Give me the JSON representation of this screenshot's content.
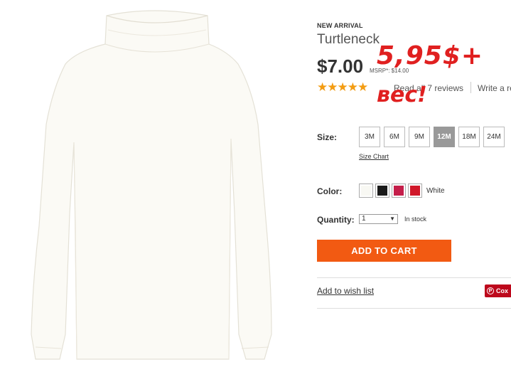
{
  "product": {
    "badge": "NEW ARRIVAL",
    "title": "Turtleneck",
    "price": "$7.00",
    "msrp": "MSRP*: $14.00",
    "rating_stars": "★★★★★",
    "rating_value": 5,
    "reviews_link": "Read all 7 reviews",
    "write_review": "Write a re"
  },
  "annotation": {
    "price_note": "5,95$+",
    "weight_note": "вес!",
    "color": "#e02020"
  },
  "size": {
    "label": "Size:",
    "options": [
      "3M",
      "6M",
      "9M",
      "12M",
      "18M",
      "24M"
    ],
    "selected": "12M",
    "chart_link": "Size Chart"
  },
  "color": {
    "label": "Color:",
    "swatches": [
      {
        "name": "white",
        "hex": "#f8f8f3"
      },
      {
        "name": "black",
        "hex": "#1a1a1a"
      },
      {
        "name": "raspberry",
        "hex": "#c41e4a"
      },
      {
        "name": "red",
        "hex": "#d0182a"
      }
    ],
    "selected_name": "White"
  },
  "quantity": {
    "label": "Quantity:",
    "value": "1",
    "stock_status": "In stock"
  },
  "actions": {
    "add_to_cart": "ADD TO CART",
    "wishlist": "Add to wish list",
    "pin_label": "Cox",
    "accent": "#f25a12"
  }
}
